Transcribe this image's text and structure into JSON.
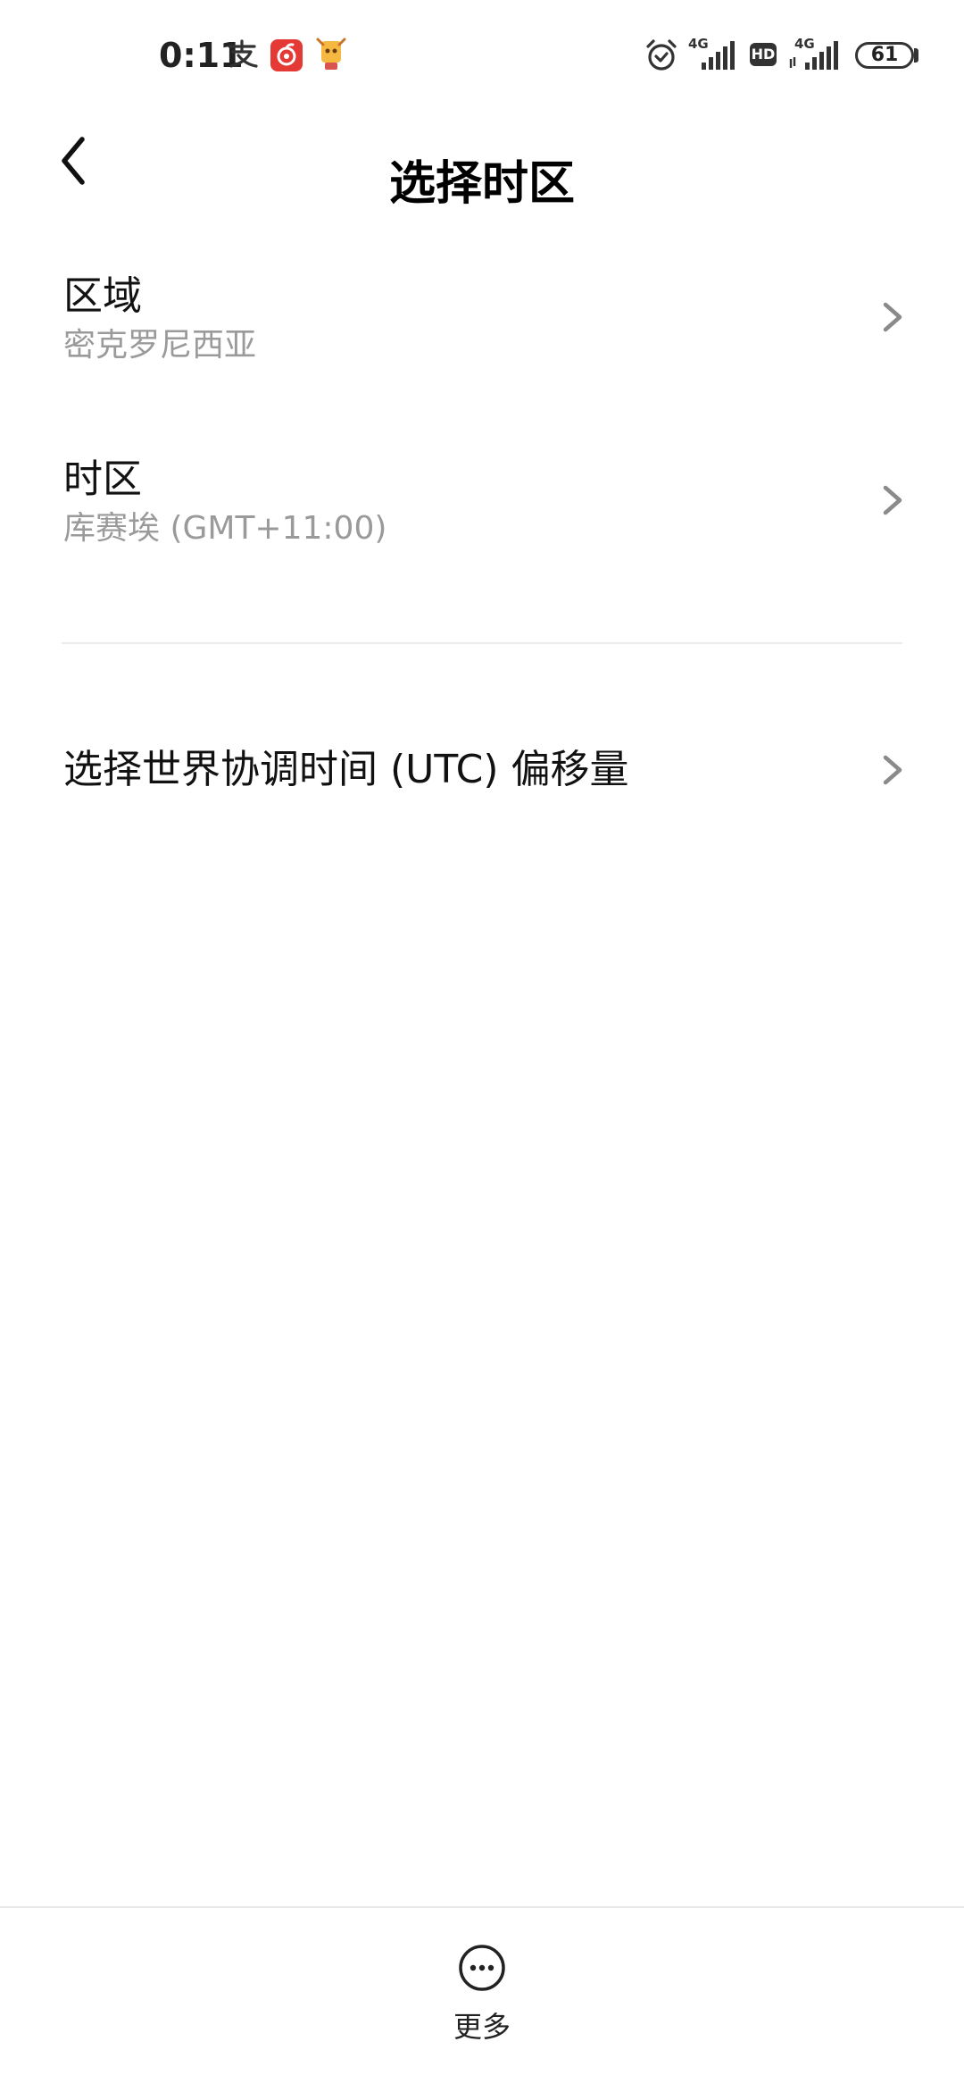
{
  "status_bar": {
    "time": "0:11",
    "left_icons": [
      "alipay-icon",
      "netease-music-icon",
      "game-app-icon"
    ],
    "right_icons": [
      "alarm-icon",
      "signal-4g-icon",
      "hd-icon",
      "signal-4g-icon-2"
    ],
    "network_label_1": "4G",
    "hd_label": "HD",
    "network_label_2": "4G",
    "battery": "61"
  },
  "header": {
    "title": "选择时区",
    "back_icon": "chevron-left-icon"
  },
  "list": [
    {
      "title": "区域",
      "subtitle": "密克罗尼西亚"
    },
    {
      "title": "时区",
      "subtitle": "库赛埃 (GMT+11:00)"
    },
    {
      "title": "选择世界协调时间 (UTC) 偏移量"
    }
  ],
  "bottom_bar": {
    "more_label": "更多",
    "more_icon": "more-dots-icon"
  },
  "colors": {
    "background": "#ffffff",
    "title_text": "#111111",
    "subtitle_text": "#9a9a9a",
    "chevron": "#8a8a8a",
    "netease_red": "#e53935"
  }
}
